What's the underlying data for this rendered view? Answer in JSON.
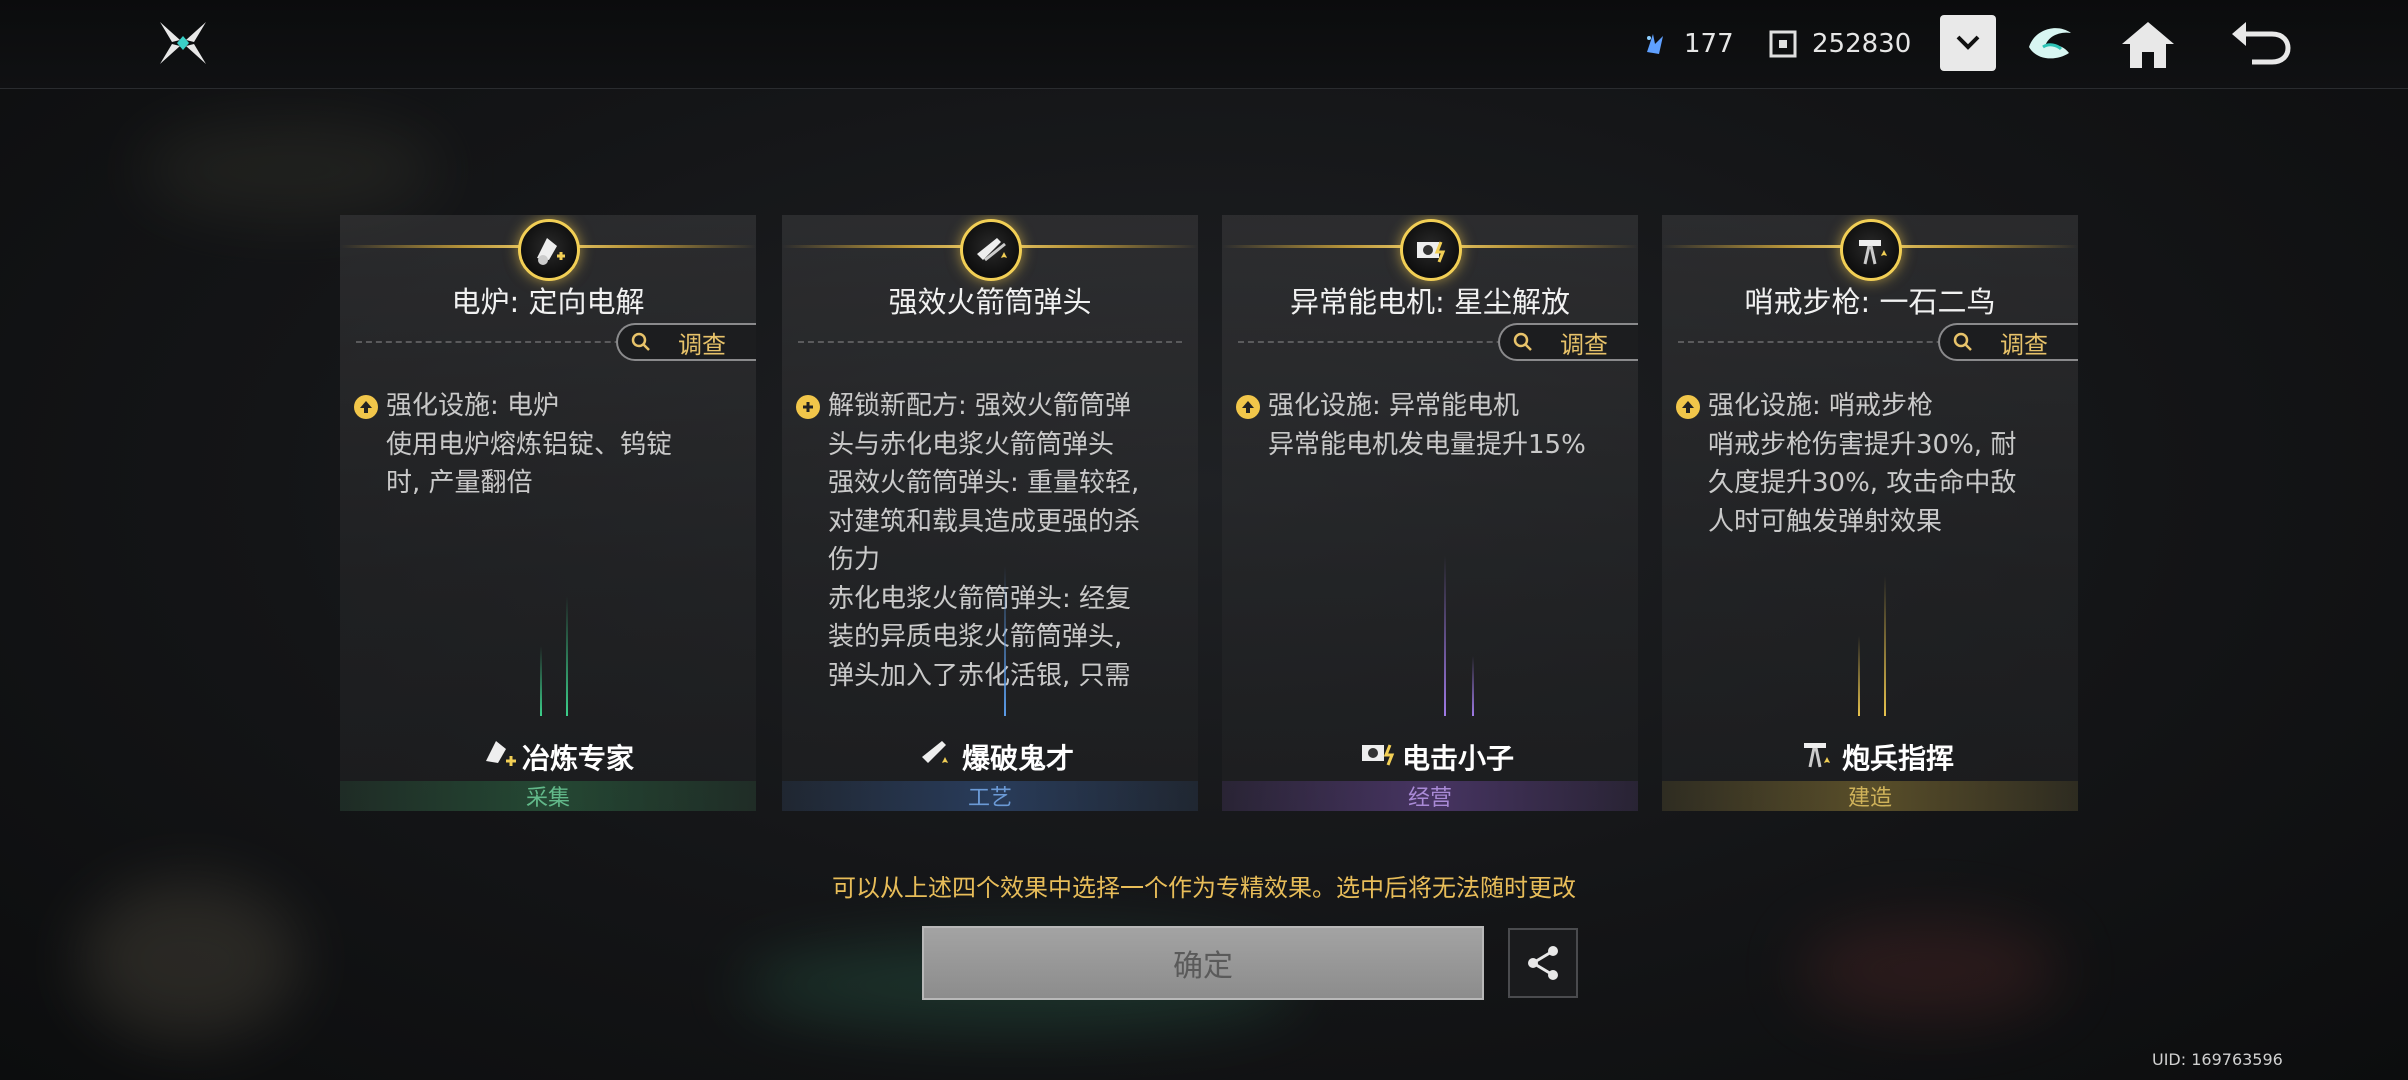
{
  "header": {
    "resource1": {
      "icon": "crystal-shard-icon",
      "value": "177"
    },
    "resource2": {
      "icon": "currency-chip-icon",
      "value": "252830"
    }
  },
  "cards": [
    {
      "title": "电炉: 定向电解",
      "inspect_label": "调查",
      "bullet_icon": "upgrade-arrow-icon",
      "description": "强化设施: 电炉\n使用电炉熔炼铝锭、钨锭\n时, 产量翻倍",
      "role": "冶炼专家",
      "category": "采集",
      "category_color": "#3d8a5a"
    },
    {
      "title": "强效火箭筒弹头",
      "inspect_label": "调查",
      "bullet_icon": "plus-circle-icon",
      "description": "解锁新配方: 强效火箭筒弹\n头与赤化电浆火箭筒弹头\n强效火箭筒弹头: 重量较轻,\n对建筑和载具造成更强的杀\n伤力\n赤化电浆火箭筒弹头: 经复\n装的异质电浆火箭筒弹头,\n弹头加入了赤化活银, 只需\n要接触就能引发大规模的辐",
      "role": "爆破鬼才",
      "category": "工艺",
      "category_color": "#3f6ea8"
    },
    {
      "title": "异常能电机: 星尘解放",
      "inspect_label": "调查",
      "bullet_icon": "upgrade-arrow-icon",
      "description": "强化设施: 异常能电机\n异常能电机发电量提升15%",
      "role": "电击小子",
      "category": "经营",
      "category_color": "#7a5aa8"
    },
    {
      "title": "哨戒步枪: 一石二鸟",
      "inspect_label": "调查",
      "bullet_icon": "upgrade-arrow-icon",
      "description": "强化设施: 哨戒步枪\n哨戒步枪伤害提升30%, 耐\n久度提升30%, 攻击命中敌\n人时可触发弹射效果",
      "role": "炮兵指挥",
      "category": "建造",
      "category_color": "#a8923f"
    }
  ],
  "notice": "可以从上述四个效果中选择一个作为专精效果。选中后将无法随时更改",
  "confirm_label": "确定",
  "uid": "UID: 169763596"
}
